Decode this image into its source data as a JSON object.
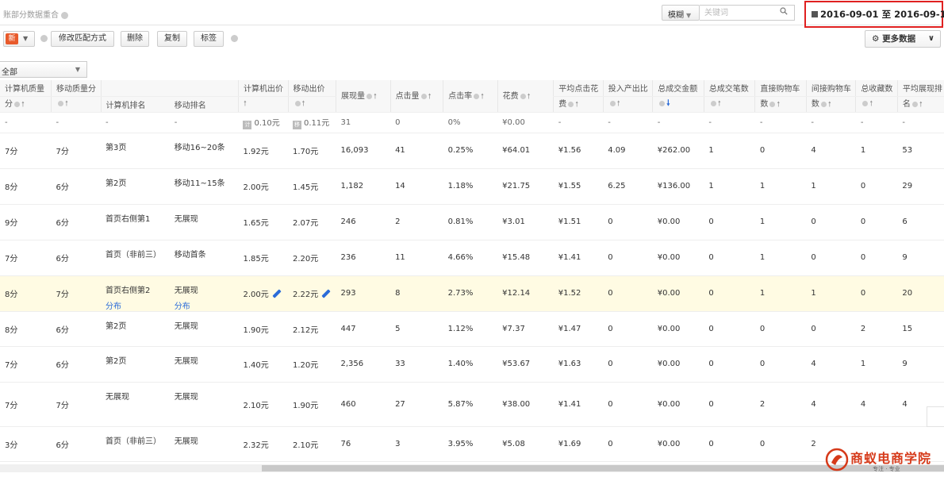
{
  "header": {
    "title": "账部分数据重合",
    "match_mode": "模糊",
    "search_placeholder": "关键词",
    "date_range": "2016-09-01 至 2016-09-15"
  },
  "toolbar": {
    "new_badge": "新",
    "buttons": [
      "修改匹配方式",
      "删除",
      "复制",
      "标签"
    ],
    "more_data": "更多数据"
  },
  "filter": {
    "selected": "全部"
  },
  "columns": [
    {
      "l1": "计算机质量",
      "l2": "分"
    },
    {
      "l1": "移动质量分",
      "l2": ""
    },
    {
      "l1": "",
      "l2": "计算机排名"
    },
    {
      "l1": "",
      "l2": "移动排名"
    },
    {
      "l1": "计算机出价",
      "l2": ""
    },
    {
      "l1": "移动出价",
      "l2": ""
    },
    {
      "l1": "展现量",
      "l2": ""
    },
    {
      "l1": "点击量",
      "l2": ""
    },
    {
      "l1": "点击率",
      "l2": ""
    },
    {
      "l1": "花费",
      "l2": ""
    },
    {
      "l1": "平均点击花",
      "l2": "费"
    },
    {
      "l1": "投入产出比",
      "l2": ""
    },
    {
      "l1": "总成交金额",
      "l2": ""
    },
    {
      "l1": "总成交笔数",
      "l2": ""
    },
    {
      "l1": "直接购物车",
      "l2": "数"
    },
    {
      "l1": "间接购物车",
      "l2": "数"
    },
    {
      "l1": "总收藏数",
      "l2": ""
    },
    {
      "l1": "平均展现排",
      "l2": "名"
    }
  ],
  "summary": {
    "c0": "-",
    "c1": "-",
    "c2": "-",
    "c3": "-",
    "pc_tag": "计",
    "pc_bid": "0.10元",
    "m_tag": "移",
    "m_bid": "0.11元",
    "c6": "31",
    "c7": "0",
    "c8": "0%",
    "c9": "¥0.00",
    "c10": "-",
    "c11": "-",
    "c12": "-",
    "c13": "-",
    "c14": "-",
    "c15": "-",
    "c16": "-",
    "c17": "-"
  },
  "rows": [
    {
      "c0": "7分",
      "c1": "7分",
      "c2": "第3页",
      "c3": "移动16~20条",
      "c4": "1.92元",
      "c5": "1.70元",
      "c6": "16,093",
      "c7": "41",
      "c8": "0.25%",
      "c9": "¥64.01",
      "c10": "¥1.56",
      "c11": "4.09",
      "c12": "¥262.00",
      "c13": "1",
      "c14": "0",
      "c15": "4",
      "c16": "1",
      "c17": "53"
    },
    {
      "c0": "8分",
      "c1": "6分",
      "c2": "第2页",
      "c3": "移动11~15条",
      "c4": "2.00元",
      "c5": "1.45元",
      "c6": "1,182",
      "c7": "14",
      "c8": "1.18%",
      "c9": "¥21.75",
      "c10": "¥1.55",
      "c11": "6.25",
      "c12": "¥136.00",
      "c13": "1",
      "c14": "1",
      "c15": "1",
      "c16": "0",
      "c17": "29"
    },
    {
      "c0": "9分",
      "c1": "6分",
      "c2": "首页右侧第1",
      "c3": "无展现",
      "c4": "1.65元",
      "c5": "2.07元",
      "c6": "246",
      "c7": "2",
      "c8": "0.81%",
      "c9": "¥3.01",
      "c10": "¥1.51",
      "c11": "0",
      "c12": "¥0.00",
      "c13": "0",
      "c14": "1",
      "c15": "0",
      "c16": "0",
      "c17": "6"
    },
    {
      "c0": "7分",
      "c1": "6分",
      "c2": "首页（非前三）",
      "c3": "移动首条",
      "c4": "1.85元",
      "c5": "2.20元",
      "c6": "236",
      "c7": "11",
      "c8": "4.66%",
      "c9": "¥15.48",
      "c10": "¥1.41",
      "c11": "0",
      "c12": "¥0.00",
      "c13": "0",
      "c14": "1",
      "c15": "0",
      "c16": "0",
      "c17": "9"
    },
    {
      "c0": "8分",
      "c1": "7分",
      "c2": "首页右侧第2",
      "c2_link": "分布",
      "c3": "无展现",
      "c3_link": "分布",
      "c4": "2.00元",
      "c5": "2.22元",
      "c6": "293",
      "c7": "8",
      "c8": "2.73%",
      "c9": "¥12.14",
      "c10": "¥1.52",
      "c11": "0",
      "c12": "¥0.00",
      "c13": "0",
      "c14": "1",
      "c15": "1",
      "c16": "0",
      "c17": "20"
    },
    {
      "c0": "8分",
      "c1": "6分",
      "c2": "第2页",
      "c3": "无展现",
      "c4": "1.90元",
      "c5": "2.12元",
      "c6": "447",
      "c7": "5",
      "c8": "1.12%",
      "c9": "¥7.37",
      "c10": "¥1.47",
      "c11": "0",
      "c12": "¥0.00",
      "c13": "0",
      "c14": "0",
      "c15": "0",
      "c16": "2",
      "c17": "15"
    },
    {
      "c0": "7分",
      "c1": "6分",
      "c2": "第2页",
      "c3": "无展现",
      "c4": "1.40元",
      "c5": "1.20元",
      "c6": "2,356",
      "c7": "33",
      "c8": "1.40%",
      "c9": "¥53.67",
      "c10": "¥1.63",
      "c11": "0",
      "c12": "¥0.00",
      "c13": "0",
      "c14": "0",
      "c15": "4",
      "c16": "1",
      "c17": "9"
    },
    {
      "c0": "7分",
      "c1": "7分",
      "c2": "无展现",
      "c3": "无展现",
      "c4": "2.10元",
      "c5": "1.90元",
      "c6": "460",
      "c7": "27",
      "c8": "5.87%",
      "c9": "¥38.00",
      "c10": "¥1.41",
      "c11": "0",
      "c12": "¥0.00",
      "c13": "0",
      "c14": "2",
      "c15": "4",
      "c16": "4",
      "c17": "4"
    },
    {
      "c0": "3分",
      "c1": "6分",
      "c2": "首页（非前三）",
      "c3": "无展现",
      "c4": "2.32元",
      "c5": "2.10元",
      "c6": "76",
      "c7": "3",
      "c8": "3.95%",
      "c9": "¥5.08",
      "c10": "¥1.69",
      "c11": "0",
      "c12": "¥0.00",
      "c13": "0",
      "c14": "0",
      "c15": "2",
      "c16": "",
      "c17": ""
    }
  ],
  "watermark": {
    "name": "商蚁电商学院",
    "tagline": "专注 · 专业"
  },
  "colors": {
    "accent_red": "#e02020",
    "link_blue": "#2b6cd8",
    "highlight_row": "#fffbe3",
    "brand_red": "#d63a1a"
  }
}
